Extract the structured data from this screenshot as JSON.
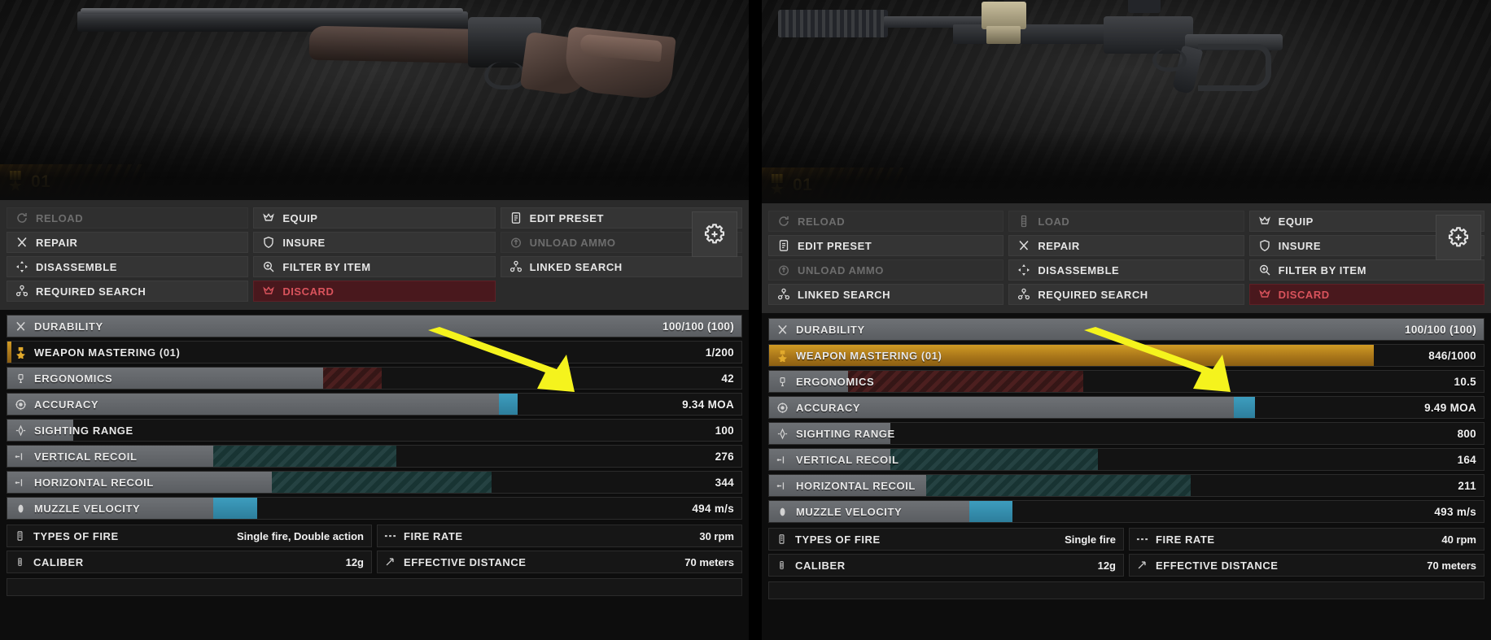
{
  "panels": [
    {
      "id": "left",
      "mastery_badge": {
        "icon": "medal-icon",
        "level": "01"
      },
      "context_menu": {
        "rows": [
          [
            {
              "label": "RELOAD",
              "icon": "reload-icon",
              "state": "disabled"
            },
            {
              "label": "EQUIP",
              "icon": "equip-crown-icon",
              "state": "enabled"
            },
            {
              "label": "EDIT PRESET",
              "icon": "edit-preset-icon",
              "state": "enabled"
            }
          ],
          [
            {
              "label": "REPAIR",
              "icon": "repair-wrench-icon",
              "state": "enabled"
            },
            {
              "label": "INSURE",
              "icon": "insure-shield-icon",
              "state": "enabled"
            },
            {
              "label": "UNLOAD AMMO",
              "icon": "unload-ammo-icon",
              "state": "disabled"
            }
          ],
          [
            {
              "label": "DISASSEMBLE",
              "icon": "disassemble-icon",
              "state": "enabled"
            },
            {
              "label": "FILTER BY ITEM",
              "icon": "filter-search-icon",
              "state": "enabled"
            },
            {
              "label": "LINKED SEARCH",
              "icon": "linked-search-icon",
              "state": "enabled"
            }
          ],
          [
            {
              "label": "REQUIRED SEARCH",
              "icon": "required-search-icon",
              "state": "enabled"
            },
            {
              "label": "DISCARD",
              "icon": "discard-crown-icon",
              "state": "danger"
            },
            {
              "label": "",
              "icon": "",
              "state": "empty"
            }
          ]
        ],
        "mods_button": {
          "icon": "mods-gear-icon"
        }
      },
      "stats": [
        {
          "name": "DURABILITY",
          "value": "100/100 (100)",
          "icon": "durability-icon",
          "fill": "grey",
          "pct": 100
        },
        {
          "name": "WEAPON MASTERING (01)",
          "value": "1/200",
          "icon": "mastery-medal-icon",
          "fill": "gold",
          "pct": 0.5
        },
        {
          "name": "ERGONOMICS",
          "value": "42",
          "icon": "ergonomics-icon",
          "fill": "grey",
          "pct": 43,
          "overlay": {
            "fill": "red",
            "from": 43,
            "to": 51
          }
        },
        {
          "name": "ACCURACY",
          "value": "9.34 MOA",
          "icon": "accuracy-icon",
          "fill": "grey",
          "pct": 68,
          "marker": {
            "fill": "blue",
            "from": 67,
            "to": 69.5
          }
        },
        {
          "name": "SIGHTING RANGE",
          "value": "100",
          "icon": "sighting-range-icon",
          "fill": "grey",
          "pct": 9
        },
        {
          "name": "VERTICAL RECOIL",
          "value": "276",
          "icon": "vertical-recoil-icon",
          "fill": "grey",
          "pct": 28,
          "overlay": {
            "fill": "teal",
            "from": 28,
            "to": 53
          }
        },
        {
          "name": "HORIZONTAL RECOIL",
          "value": "344",
          "icon": "horizontal-recoil-icon",
          "fill": "grey",
          "pct": 36,
          "overlay": {
            "fill": "teal",
            "from": 36,
            "to": 66
          }
        },
        {
          "name": "MUZZLE VELOCITY",
          "value": "494 m/s",
          "icon": "muzzle-velocity-icon",
          "fill": "grey",
          "pct": 28,
          "overlay": {
            "fill": "blue",
            "from": 28,
            "to": 34
          }
        }
      ],
      "info": [
        [
          {
            "label": "TYPES OF FIRE",
            "value": "Single fire, Double action",
            "icon": "types-of-fire-icon"
          },
          {
            "label": "FIRE RATE",
            "value": "30 rpm",
            "icon": "fire-rate-icon"
          }
        ],
        [
          {
            "label": "CALIBER",
            "value": "12g",
            "icon": "caliber-icon"
          },
          {
            "label": "EFFECTIVE DISTANCE",
            "value": "70 meters",
            "icon": "effective-distance-icon"
          }
        ]
      ]
    },
    {
      "id": "right",
      "mastery_badge": {
        "icon": "medal-icon",
        "level": "01"
      },
      "context_menu": {
        "rows": [
          [
            {
              "label": "RELOAD",
              "icon": "reload-icon",
              "state": "disabled"
            },
            {
              "label": "LOAD",
              "icon": "load-icon",
              "state": "disabled"
            },
            {
              "label": "EQUIP",
              "icon": "equip-crown-icon",
              "state": "enabled"
            }
          ],
          [
            {
              "label": "EDIT PRESET",
              "icon": "edit-preset-icon",
              "state": "enabled"
            },
            {
              "label": "REPAIR",
              "icon": "repair-wrench-icon",
              "state": "enabled"
            },
            {
              "label": "INSURE",
              "icon": "insure-shield-icon",
              "state": "enabled"
            }
          ],
          [
            {
              "label": "UNLOAD AMMO",
              "icon": "unload-ammo-icon",
              "state": "disabled"
            },
            {
              "label": "DISASSEMBLE",
              "icon": "disassemble-icon",
              "state": "enabled"
            },
            {
              "label": "FILTER BY ITEM",
              "icon": "filter-search-icon",
              "state": "enabled"
            }
          ],
          [
            {
              "label": "LINKED SEARCH",
              "icon": "linked-search-icon",
              "state": "enabled"
            },
            {
              "label": "REQUIRED SEARCH",
              "icon": "required-search-icon",
              "state": "enabled"
            },
            {
              "label": "DISCARD",
              "icon": "discard-crown-icon",
              "state": "danger"
            }
          ]
        ],
        "mods_button": {
          "icon": "mods-gear-icon"
        }
      },
      "stats": [
        {
          "name": "DURABILITY",
          "value": "100/100 (100)",
          "icon": "durability-icon",
          "fill": "grey",
          "pct": 100
        },
        {
          "name": "WEAPON MASTERING (01)",
          "value": "846/1000",
          "icon": "mastery-medal-icon",
          "fill": "gold",
          "pct": 84.6
        },
        {
          "name": "ERGONOMICS",
          "value": "10.5",
          "icon": "ergonomics-icon",
          "fill": "grey",
          "pct": 11,
          "overlay": {
            "fill": "red",
            "from": 11,
            "to": 44
          }
        },
        {
          "name": "ACCURACY",
          "value": "9.49 MOA",
          "icon": "accuracy-icon",
          "fill": "grey",
          "pct": 66,
          "marker": {
            "fill": "blue",
            "from": 65,
            "to": 68
          }
        },
        {
          "name": "SIGHTING RANGE",
          "value": "800",
          "icon": "sighting-range-icon",
          "fill": "grey",
          "pct": 17
        },
        {
          "name": "VERTICAL RECOIL",
          "value": "164",
          "icon": "vertical-recoil-icon",
          "fill": "grey",
          "pct": 17,
          "overlay": {
            "fill": "teal",
            "from": 17,
            "to": 46
          }
        },
        {
          "name": "HORIZONTAL RECOIL",
          "value": "211",
          "icon": "horizontal-recoil-icon",
          "fill": "grey",
          "pct": 22,
          "overlay": {
            "fill": "teal",
            "from": 22,
            "to": 59
          }
        },
        {
          "name": "MUZZLE VELOCITY",
          "value": "493 m/s",
          "icon": "muzzle-velocity-icon",
          "fill": "grey",
          "pct": 28,
          "overlay": {
            "fill": "blue",
            "from": 28,
            "to": 34
          }
        }
      ],
      "info": [
        [
          {
            "label": "TYPES OF FIRE",
            "value": "Single fire",
            "icon": "types-of-fire-icon"
          },
          {
            "label": "FIRE RATE",
            "value": "40 rpm",
            "icon": "fire-rate-icon"
          }
        ],
        [
          {
            "label": "CALIBER",
            "value": "12g",
            "icon": "caliber-icon"
          },
          {
            "label": "EFFECTIVE DISTANCE",
            "value": "70 meters",
            "icon": "effective-distance-icon"
          }
        ]
      ]
    }
  ],
  "annotations": {
    "arrow_color": "#f5f31d",
    "arrows": [
      {
        "target": "left-accuracy-stat"
      },
      {
        "target": "right-accuracy-stat"
      }
    ]
  },
  "colors": {
    "gold": "#c98f20",
    "blue": "#3d9dbe",
    "red": "#d9535c",
    "menu_bg": "#2b2b2b",
    "stat_bg": "#131313"
  }
}
